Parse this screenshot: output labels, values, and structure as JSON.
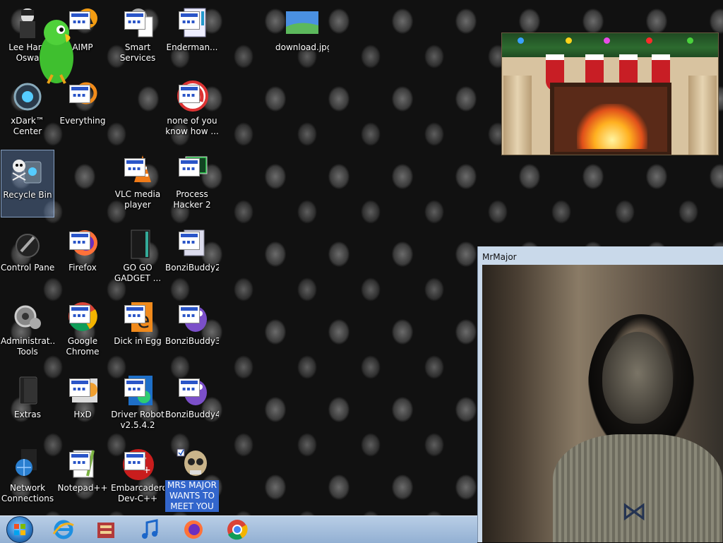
{
  "desktop": {
    "icons": [
      {
        "label": "Lee Harv Oswa",
        "icon": "portrait-icon"
      },
      {
        "label": "AIMP",
        "icon": "aimp-icon"
      },
      {
        "label": "Smart Services",
        "icon": "gear-window-icon"
      },
      {
        "label": "Enderman...",
        "icon": "app-window-icon"
      },
      {
        "label": "download.jpg",
        "icon": "image-file-icon"
      },
      {
        "label": "xDark™ Center",
        "icon": "xdark-icon"
      },
      {
        "label": "Everything",
        "icon": "search-circle-icon"
      },
      {
        "label": "none of you know how ...",
        "icon": "red-circle-icon"
      },
      {
        "label": "Recycle Bin",
        "icon": "recycle-bin-icon"
      },
      {
        "label": "VLC media player",
        "icon": "vlc-cone-icon"
      },
      {
        "label": "Process Hacker 2",
        "icon": "process-hacker-icon"
      },
      {
        "label": "Control Panel",
        "icon": "control-panel-icon"
      },
      {
        "label": "Firefox",
        "icon": "firefox-icon"
      },
      {
        "label": "GO GO GADGET ...",
        "icon": "black-box-icon"
      },
      {
        "label": "BonziBuddy2",
        "icon": "app-window-icon"
      },
      {
        "label": "Administrat... Tools",
        "icon": "admin-tools-icon"
      },
      {
        "label": "Google Chrome",
        "icon": "chrome-icon"
      },
      {
        "label": "Dick in Egg",
        "icon": "egg-icon"
      },
      {
        "label": "BonziBuddy3",
        "icon": "bonzi-icon"
      },
      {
        "label": "Extras",
        "icon": "folder-black-icon"
      },
      {
        "label": "HxD",
        "icon": "hxd-icon"
      },
      {
        "label": "Driver Robot v2.5.4.2",
        "icon": "driver-robot-icon"
      },
      {
        "label": "BonziBuddy4",
        "icon": "bonzi-icon"
      },
      {
        "label": "Network Connections",
        "icon": "network-icon"
      },
      {
        "label": "Notepad++",
        "icon": "notepad-icon"
      },
      {
        "label": "Embarcadero Dev-C++",
        "icon": "devcpp-icon"
      },
      {
        "label": "MRS MAJOR WANTS TO MEET YOU",
        "icon": "skull-icon",
        "selected": true
      }
    ]
  },
  "window": {
    "title": "MrMajor"
  },
  "taskbar": {
    "items": [
      "start-orb-icon",
      "internet-explorer-icon",
      "archive-icon",
      "music-note-icon",
      "firefox-icon",
      "chrome-icon"
    ]
  }
}
